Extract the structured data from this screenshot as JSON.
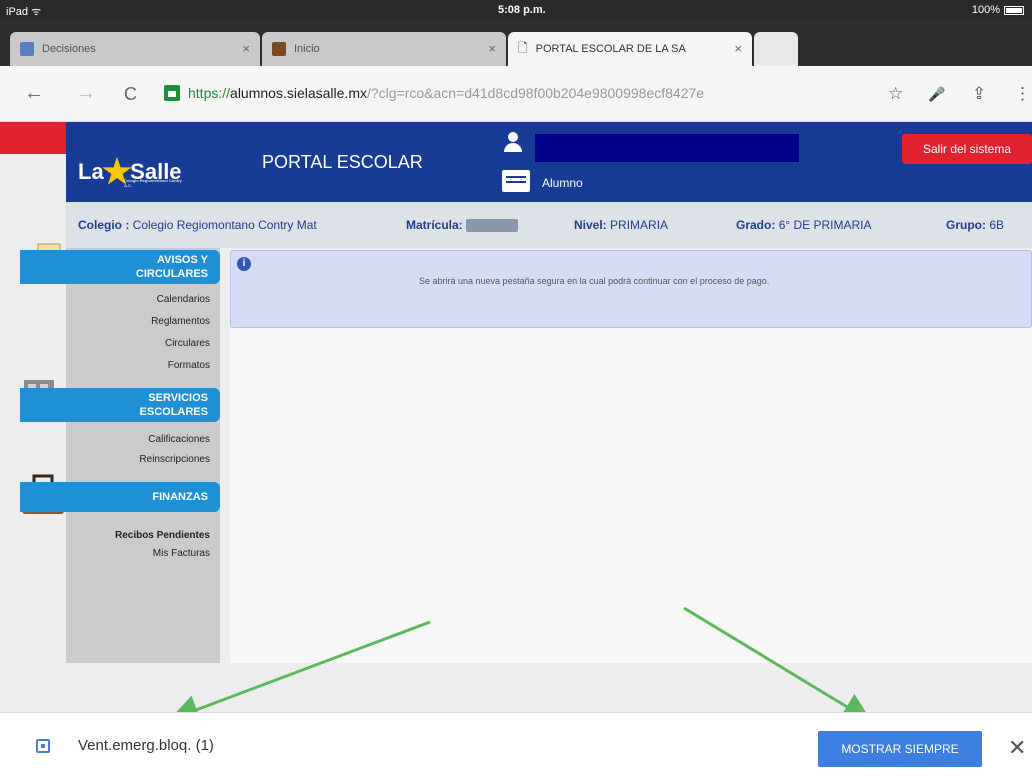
{
  "status_bar": {
    "device": "iPad ᯤ",
    "time": "5:08 p.m.",
    "battery": "100%"
  },
  "tabs": [
    {
      "label": "Decisiones",
      "close": "×",
      "favicon_color": "#5a7fbf"
    },
    {
      "label": "Inicio",
      "close": "×",
      "favicon_color": "#7a4a22"
    },
    {
      "label": "PORTAL ESCOLAR DE LA SA",
      "close": "×",
      "icon": "page-icon",
      "active": true
    }
  ],
  "omnibar": {
    "back": "←",
    "forward": "→",
    "reload": "C",
    "url_scheme": "https://",
    "url_host": "alumnos.sielasalle.mx",
    "url_rest": "/?clg=rco&acn=d41d8cd98f00b204e9800998ecf8427e",
    "star": "☆",
    "mic": "🎤",
    "share": "⇪",
    "menu": "⋮"
  },
  "header": {
    "logo_la": "La",
    "logo_star": "★",
    "logo_salle": "Salle",
    "logo_sub": "Colegio Regiomontano Contry A.C.",
    "portal_title": "PORTAL ESCOLAR",
    "role": "Alumno",
    "logout": "Salir del sistema"
  },
  "info": {
    "colegio_label": "Colegio :",
    "colegio_value": "Colegio Regiomontano Contry Mat",
    "matricula_label": "Matrícula:",
    "nivel_label": "Nivel:",
    "nivel_value": "PRIMARIA",
    "grado_label": "Grado:",
    "grado_value": "6° DE PRIMARIA",
    "grupo_label": "Grupo:",
    "grupo_value": "6B"
  },
  "sidebar": {
    "avisos": {
      "title1": "AVISOS Y",
      "title2": "CIRCULARES",
      "items": [
        "Calendarios",
        "Reglamentos",
        "Circulares",
        "Formatos"
      ]
    },
    "servicios": {
      "title1": "SERVICIOS",
      "title2": "ESCOLARES",
      "items": [
        "Calificaciones",
        "Reinscripciones"
      ]
    },
    "finanzas": {
      "title": "FINANZAS",
      "items": [
        "Recibos Pendientes",
        "Mis Facturas"
      ]
    }
  },
  "alert": {
    "icon": "i",
    "text": "Se abrirá una nueva pestaña segura en la cual podrá continuar con el proceso de pago."
  },
  "download_bar": {
    "label": "Vent.emerg.bloq. (1)",
    "button": "MOSTRAR SIEMPRE",
    "close": "✕"
  },
  "colors": {
    "header_blue": "#183c95",
    "accent_red": "#e3222f",
    "menu_blue": "#1f8fd6",
    "arrow_green": "#5cb85c",
    "button_blue": "#3d7fe0"
  }
}
